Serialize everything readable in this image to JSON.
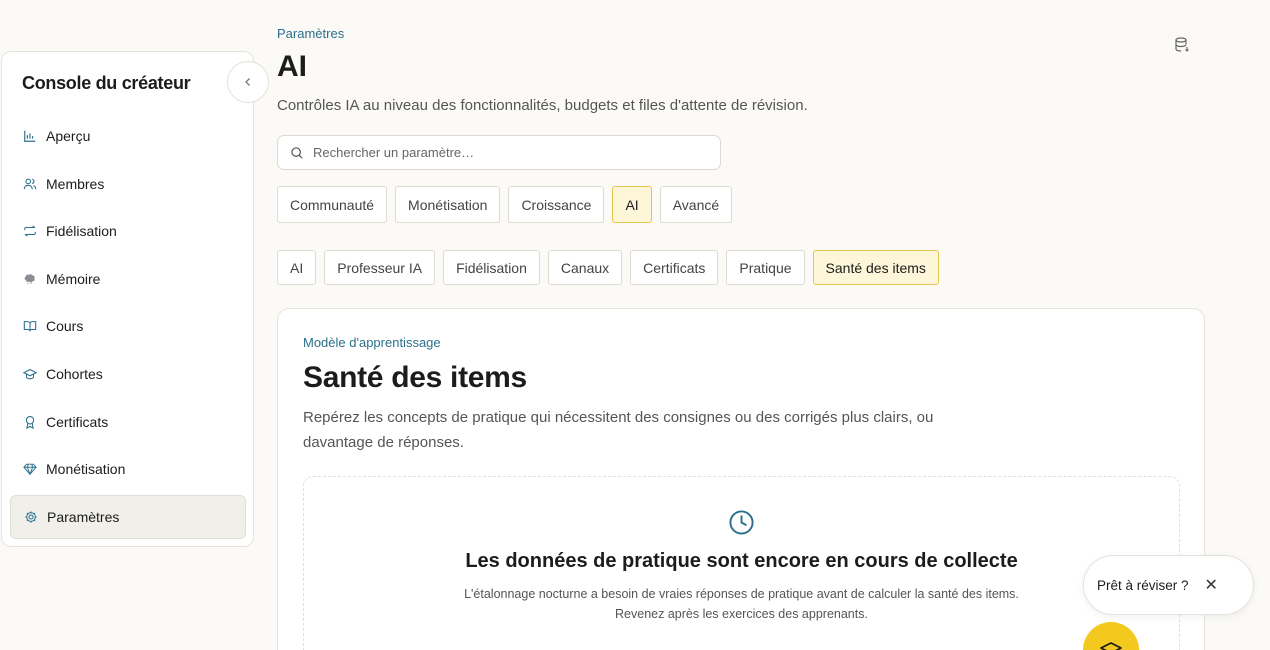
{
  "sidebar": {
    "title": "Console du créateur",
    "items": [
      {
        "label": "Aperçu",
        "icon": "bar-chart-icon"
      },
      {
        "label": "Membres",
        "icon": "users-icon"
      },
      {
        "label": "Fidélisation",
        "icon": "repeat-icon"
      },
      {
        "label": "Mémoire",
        "icon": "brain-icon"
      },
      {
        "label": "Cours",
        "icon": "book-icon"
      },
      {
        "label": "Cohortes",
        "icon": "graduation-cap-icon"
      },
      {
        "label": "Certificats",
        "icon": "award-icon"
      },
      {
        "label": "Monétisation",
        "icon": "gem-icon"
      },
      {
        "label": "Paramètres",
        "icon": "gear-icon"
      }
    ],
    "active": "Paramètres"
  },
  "header": {
    "breadcrumb": "Paramètres",
    "title": "AI",
    "subtitle": "Contrôles IA au niveau des fonctionnalités, budgets et files d'attente de révision."
  },
  "search": {
    "placeholder": "Rechercher un paramètre…",
    "value": ""
  },
  "tabs_primary": [
    "Communauté",
    "Monétisation",
    "Croissance",
    "AI",
    "Avancé"
  ],
  "tabs_primary_active": "AI",
  "tabs_secondary": [
    "AI",
    "Professeur IA",
    "Fidélisation",
    "Canaux",
    "Certificats",
    "Pratique",
    "Santé des items"
  ],
  "tabs_secondary_active": "Santé des items",
  "card": {
    "kicker": "Modèle d'apprentissage",
    "title": "Santé des items",
    "description": "Repérez les concepts de pratique qui nécessitent des consignes ou des corrigés plus clairs, ou davantage de réponses."
  },
  "empty_state": {
    "title": "Les données de pratique sont encore en cours de collecte",
    "line1": "L'étalonnage nocturne a besoin de vraies réponses de pratique avant de calculer la santé des items.",
    "line2": "Revenez après les exercices des apprenants."
  },
  "toast": {
    "label": "Prêt à réviser ?",
    "close": "✕"
  },
  "colors": {
    "accent": "#2b6f8c",
    "highlight": "#f4c91f",
    "active_tab_bg": "#fdf6d9",
    "active_tab_border": "#e5c64b"
  }
}
